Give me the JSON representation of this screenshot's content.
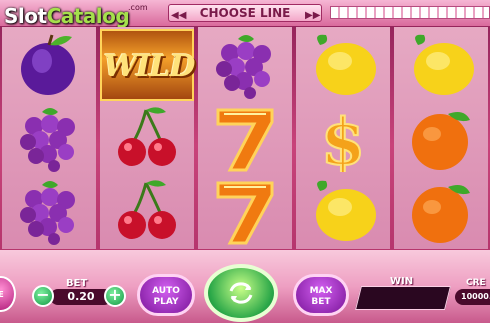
{
  "branding": {
    "logo_main": "Slot",
    "logo_accent": "Catalog",
    "logo_sub": ".com"
  },
  "header": {
    "choose_line_label": "CHOOSE LINE",
    "arrow_left_icon": "double-chevron-left-icon",
    "arrow_right_icon": "double-chevron-right-icon"
  },
  "reels": [
    [
      "plum",
      "grapes",
      "grapes"
    ],
    [
      "wild",
      "cherries",
      "cherries"
    ],
    [
      "grapes",
      "seven",
      "seven"
    ],
    [
      "lemon",
      "dollar",
      "lemon"
    ],
    [
      "lemon",
      "orange",
      "orange"
    ]
  ],
  "symbols": {
    "wild_text": "WILD"
  },
  "controls": {
    "bet_label": "BET",
    "bet_value": "0.20",
    "minus_label": "−",
    "plus_label": "+",
    "auto_play_line1": "AUTO",
    "auto_play_line2": "PLAY",
    "spin_icon": "refresh-arrows-icon",
    "max_bet_line1": "MAX",
    "max_bet_line2": "BET",
    "win_label": "WIN",
    "win_value": "",
    "credit_label": "CRE",
    "credit_value": "10000.",
    "side_button_label": "E"
  },
  "colors": {
    "background": "#c8437a",
    "reel_bg": "#e6a9c3",
    "spin_green": "#2aa748",
    "purple_button": "#7a1599",
    "wild_gold": "#f4a02a"
  }
}
